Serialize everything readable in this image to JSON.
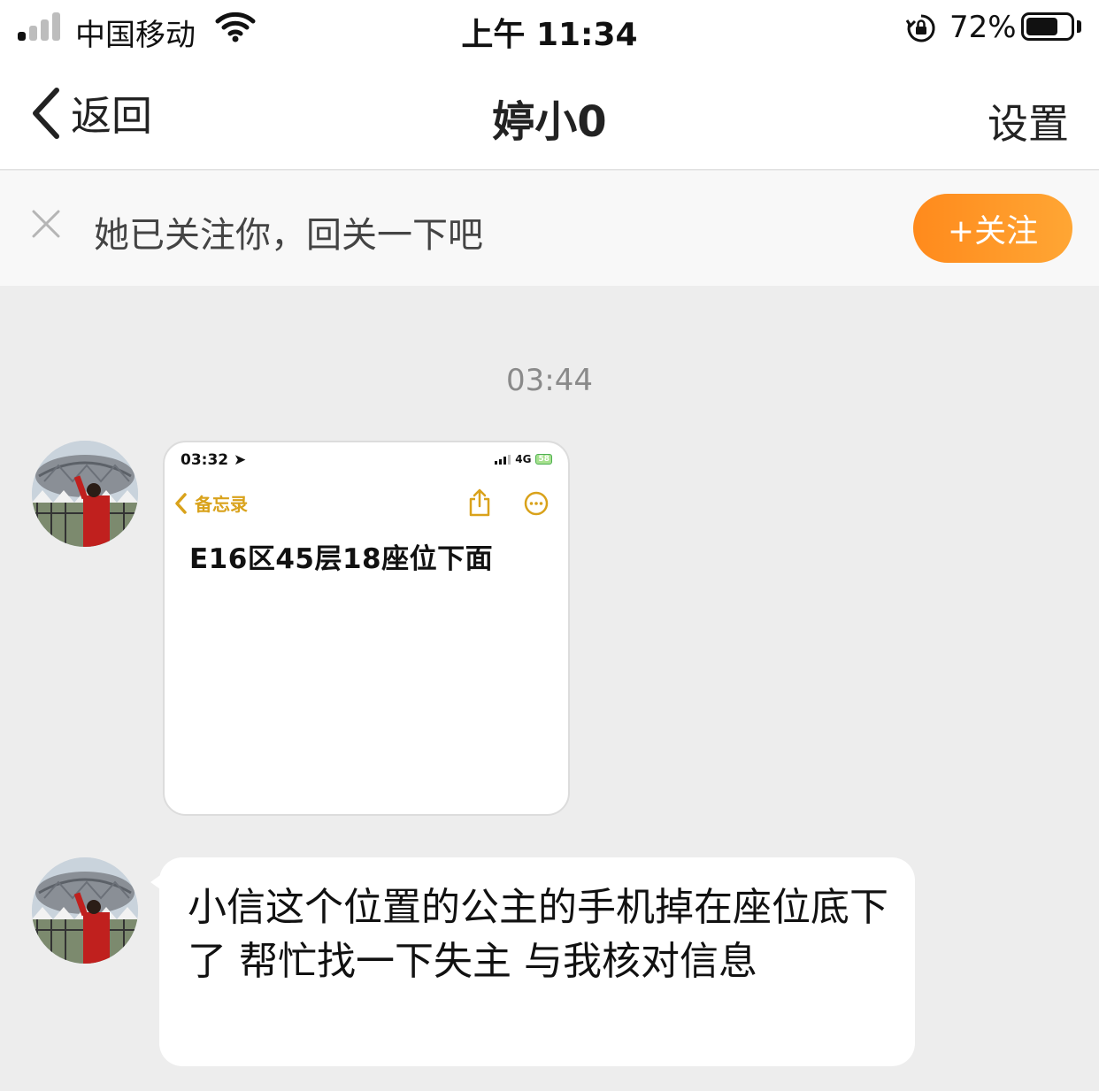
{
  "status_bar": {
    "carrier": "中国移动",
    "time": "上午 11:34",
    "battery_percent": "72%",
    "battery_level": 0.72
  },
  "nav": {
    "back_label": "返回",
    "title": "婷小0",
    "settings_label": "设置"
  },
  "follow_banner": {
    "text": "她已关注你，回关一下吧",
    "button_label": "+关注"
  },
  "chat": {
    "timestamp": "03:44",
    "image_message": {
      "status_time": "03:32",
      "network": "4G",
      "battery": "58",
      "back_label": "备忘录",
      "note_text": "E16区45层18座位下面"
    },
    "text_message": "小信这个位置的公主的手机掉在座位底下了 帮忙找一下失主 与我核对信息"
  },
  "colors": {
    "accent_orange": "#ff8a1c",
    "background": "#ededed",
    "notes_yellow": "#d9a21b"
  }
}
